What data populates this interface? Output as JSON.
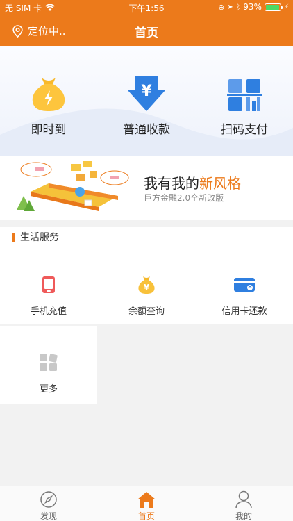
{
  "status": {
    "carrier": "无 SIM 卡",
    "time": "下午1:56",
    "battery": "93%",
    "battery_level": 0.93
  },
  "nav": {
    "location": "定位中..",
    "title": "首页"
  },
  "quick_actions": [
    {
      "label": "即时到",
      "icon": "money-bag-lightning-icon"
    },
    {
      "label": "普通收款",
      "icon": "yuan-down-arrow-icon"
    },
    {
      "label": "扫码支付",
      "icon": "qr-code-icon"
    }
  ],
  "banner": {
    "title_prefix": "我有我的",
    "title_highlight": "新风格",
    "subtitle": "巨方金融2.0全新改版"
  },
  "services": {
    "title": "生活服务",
    "items": [
      {
        "label": "手机充值",
        "icon": "phone-icon"
      },
      {
        "label": "余额查询",
        "icon": "yuan-bag-icon"
      },
      {
        "label": "信用卡还款",
        "icon": "credit-card-icon"
      },
      {
        "label": "更多",
        "icon": "grid-icon"
      }
    ]
  },
  "tabs": [
    {
      "label": "发现",
      "icon": "compass-icon"
    },
    {
      "label": "首页",
      "icon": "home-icon"
    },
    {
      "label": "我的",
      "icon": "user-icon"
    }
  ],
  "colors": {
    "brand": "#ec7a1b",
    "blue": "#2f7fe0",
    "battery": "#4cd964"
  }
}
